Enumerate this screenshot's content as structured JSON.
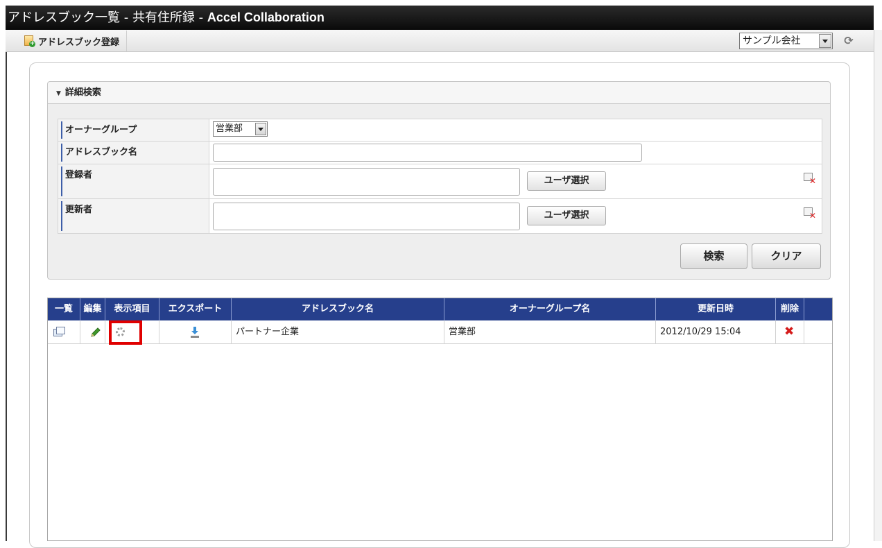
{
  "window": {
    "title_prefix": "アドレスブック一覧 - 共有住所録 - ",
    "app_name": "Accel Collaboration"
  },
  "toolbar": {
    "register_label": "アドレスブック登録",
    "company_value": "サンプル会社",
    "refresh_icon": "refresh-icon"
  },
  "search": {
    "header": "詳細検索",
    "fields": {
      "owner_group_label": "オーナーグループ",
      "owner_group_value": "営業部",
      "addressbook_name_label": "アドレスブック名",
      "addressbook_name_value": "",
      "registrant_label": "登録者",
      "registrant_value": "",
      "updater_label": "更新者",
      "updater_value": ""
    },
    "user_select_label": "ユーザ選択",
    "search_button": "検索",
    "clear_button": "クリア"
  },
  "grid": {
    "headers": [
      "一覧",
      "編集",
      "表示項目",
      "エクスポート",
      "アドレスブック名",
      "オーナーグループ名",
      "更新日時",
      "削除"
    ],
    "rows": [
      {
        "name": "パートナー企業",
        "owner_group": "営業部",
        "updated": "2012/10/29 15:04"
      }
    ]
  },
  "colors": {
    "header_blue": "#263f8c",
    "highlight_red": "#e00000",
    "title_bar": "#111111"
  }
}
